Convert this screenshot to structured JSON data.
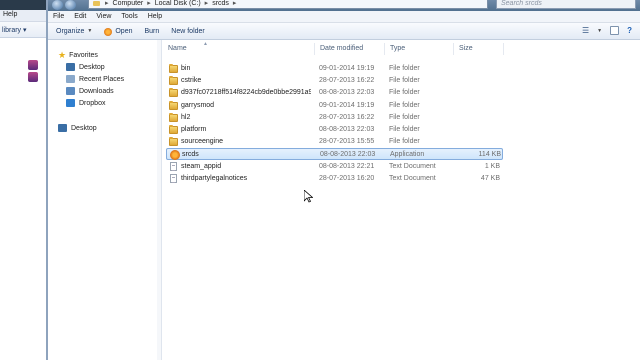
{
  "background_window": {
    "menu_help": "Help",
    "library_label": "library ▾"
  },
  "address": {
    "crumbs": [
      "Computer",
      "Local Disk (C:)",
      "srcds"
    ],
    "separator": "▸"
  },
  "search": {
    "placeholder": "Search srcds"
  },
  "menu": [
    "File",
    "Edit",
    "View",
    "Tools",
    "Help"
  ],
  "commands": {
    "organize": "Organize",
    "open": "Open",
    "burn": "Burn",
    "new_folder": "New folder"
  },
  "nav": {
    "favorites": "Favorites",
    "desktop": "Desktop",
    "recent_places": "Recent Places",
    "downloads": "Downloads",
    "dropbox": "Dropbox",
    "desktop_root": "Desktop"
  },
  "columns": {
    "name": "Name",
    "date_modified": "Date modified",
    "type": "Type",
    "size": "Size"
  },
  "files": [
    {
      "name": "bin",
      "date": "09-01-2014 19:19",
      "type": "File folder",
      "size": "",
      "icon": "folder-icon"
    },
    {
      "name": "cstrike",
      "date": "28-07-2013 16:22",
      "type": "File folder",
      "size": "",
      "icon": "folder-icon"
    },
    {
      "name": "d937fc07218ff514f8224cb9de0bbe2991a9...",
      "date": "08-08-2013 22:03",
      "type": "File folder",
      "size": "",
      "icon": "folder-icon"
    },
    {
      "name": "garrysmod",
      "date": "09-01-2014 19:19",
      "type": "File folder",
      "size": "",
      "icon": "folder-icon"
    },
    {
      "name": "hl2",
      "date": "28-07-2013 16:22",
      "type": "File folder",
      "size": "",
      "icon": "folder-icon"
    },
    {
      "name": "platform",
      "date": "08-08-2013 22:03",
      "type": "File folder",
      "size": "",
      "icon": "folder-icon"
    },
    {
      "name": "sourceengine",
      "date": "28-07-2013 15:55",
      "type": "File folder",
      "size": "",
      "icon": "folder-icon"
    },
    {
      "name": "srcds",
      "date": "08-08-2013 22:03",
      "type": "Application",
      "size": "114 KB",
      "icon": "app-icon"
    },
    {
      "name": "steam_appid",
      "date": "08-08-2013 22:21",
      "type": "Text Document",
      "size": "1 KB",
      "icon": "doc-icon"
    },
    {
      "name": "thirdpartylegalnotices",
      "date": "28-07-2013 16:20",
      "type": "Text Document",
      "size": "47 KB",
      "icon": "doc-icon"
    }
  ],
  "selected_file_index": 7,
  "colors": {
    "selection_fill": "#cfe5fb",
    "selection_border": "#84acdd",
    "folder": "#e9c35a",
    "command_text": "#1c3a66"
  }
}
